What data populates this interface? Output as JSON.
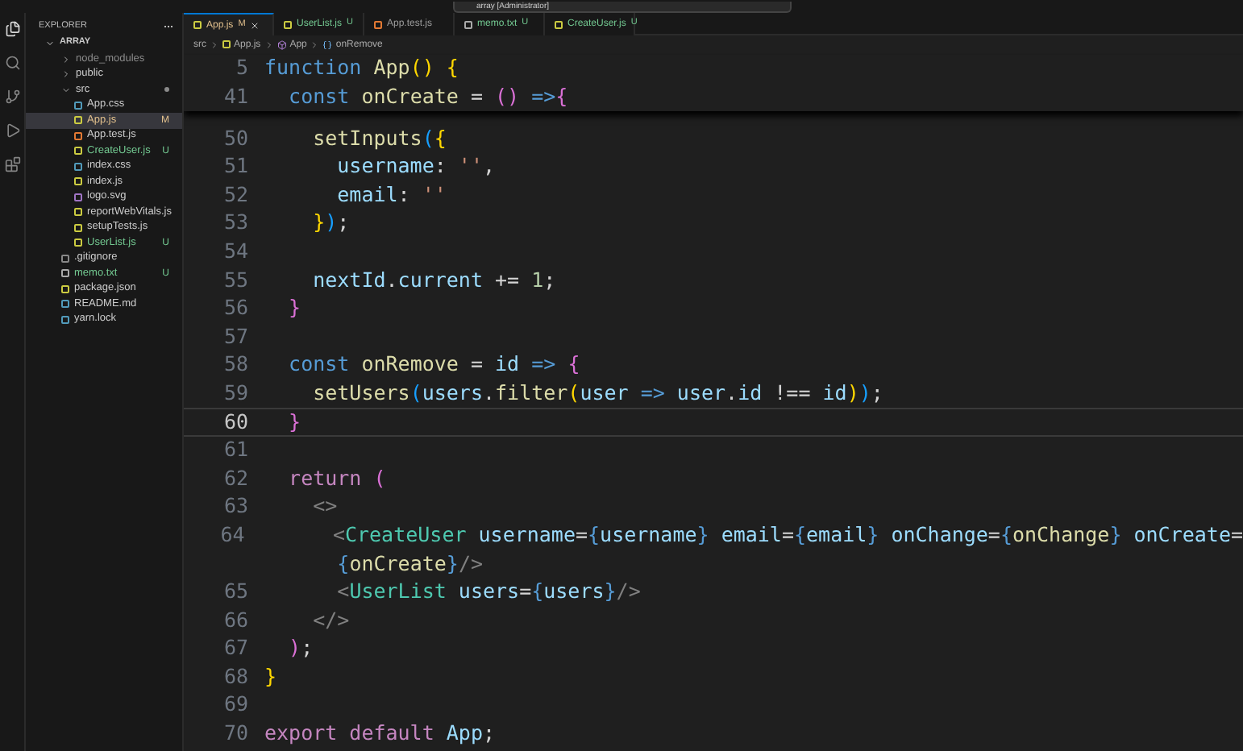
{
  "search_box": {
    "text": "array [Administrator]"
  },
  "explorer": {
    "title": "EXPLORER",
    "root": "ARRAY",
    "tree": [
      {
        "name": "node_modules",
        "kind": "folder",
        "expanded": false,
        "selected": false
      },
      {
        "name": "public",
        "kind": "folder",
        "expanded": false,
        "selected": false
      },
      {
        "name": "src",
        "kind": "folder",
        "expanded": true,
        "has_changes": true,
        "selected": false,
        "children": [
          {
            "name": "App.css",
            "kind": "css",
            "selected": false
          },
          {
            "name": "App.js",
            "kind": "js",
            "status": "M",
            "selected": true
          },
          {
            "name": "App.test.js",
            "kind": "test",
            "selected": false
          },
          {
            "name": "CreateUser.js",
            "kind": "js",
            "status": "U",
            "selected": false
          },
          {
            "name": "index.css",
            "kind": "css",
            "selected": false
          },
          {
            "name": "index.js",
            "kind": "js",
            "selected": false
          },
          {
            "name": "logo.svg",
            "kind": "svg",
            "selected": false
          },
          {
            "name": "reportWebVitals.js",
            "kind": "js",
            "selected": false
          },
          {
            "name": "setupTests.js",
            "kind": "js",
            "selected": false
          },
          {
            "name": "UserList.js",
            "kind": "js",
            "status": "U",
            "selected": false
          }
        ]
      },
      {
        "name": ".gitignore",
        "kind": "git",
        "selected": false
      },
      {
        "name": "memo.txt",
        "kind": "txt",
        "status": "U",
        "selected": false
      },
      {
        "name": "package.json",
        "kind": "json",
        "selected": false
      },
      {
        "name": "README.md",
        "kind": "md",
        "selected": false
      },
      {
        "name": "yarn.lock",
        "kind": "lock",
        "selected": false
      }
    ]
  },
  "tabs": [
    {
      "label": "App.js",
      "kind": "js",
      "status": "M",
      "selected": true
    },
    {
      "label": "UserList.js",
      "kind": "js",
      "status": "U",
      "selected": false
    },
    {
      "label": "App.test.js",
      "kind": "test",
      "selected": false
    },
    {
      "label": "memo.txt",
      "kind": "txt",
      "status": "U",
      "selected": false
    },
    {
      "label": "CreateUser.js",
      "kind": "js",
      "status": "U",
      "selected": false
    }
  ],
  "breadcrumb": [
    {
      "label": "src",
      "kind": "folder"
    },
    {
      "label": "App.js",
      "kind": "js"
    },
    {
      "label": "App",
      "kind": "component"
    },
    {
      "label": "onRemove",
      "kind": "method"
    }
  ],
  "sticky_lines": [
    {
      "number": "5",
      "tokens": [
        {
          "text": "function ",
          "kind": "kw"
        },
        {
          "text": "App",
          "kind": "fn"
        },
        {
          "text": "()",
          "kind": "br1"
        },
        {
          "text": " {",
          "kind": "br1"
        }
      ]
    },
    {
      "number": "41",
      "tokens": [
        {
          "text": "  const ",
          "kind": "kw"
        },
        {
          "text": "onCreate",
          "kind": "fn"
        },
        {
          "text": " = "
        },
        {
          "text": "()",
          "kind": "br2"
        },
        {
          "text": " =>",
          "kind": "kw"
        },
        {
          "text": "{",
          "kind": "br2"
        }
      ]
    }
  ],
  "lines": [
    {
      "number": "50",
      "current": false,
      "tokens": [
        {
          "text": "    setInputs",
          "kind": "fn"
        },
        {
          "text": "(",
          "kind": "br3"
        },
        {
          "text": "{",
          "kind": "br1"
        }
      ]
    },
    {
      "number": "51",
      "current": false,
      "tokens": [
        {
          "text": "      username",
          "kind": "var"
        },
        {
          "text": ": "
        },
        {
          "text": "''",
          "kind": "str"
        },
        {
          "text": ","
        }
      ]
    },
    {
      "number": "52",
      "current": false,
      "tokens": [
        {
          "text": "      email",
          "kind": "var"
        },
        {
          "text": ": "
        },
        {
          "text": "''",
          "kind": "str"
        }
      ]
    },
    {
      "number": "53",
      "current": false,
      "tokens": [
        {
          "text": "    }",
          "kind": "br1"
        },
        {
          "text": ")",
          "kind": "br3"
        },
        {
          "text": ";"
        }
      ]
    },
    {
      "number": "54",
      "current": false
    },
    {
      "number": "55",
      "current": false,
      "tokens": [
        {
          "text": "    nextId",
          "kind": "var"
        },
        {
          "text": "."
        },
        {
          "text": "current",
          "kind": "var"
        },
        {
          "text": " += "
        },
        {
          "text": "1",
          "kind": "num"
        },
        {
          "text": ";"
        }
      ]
    },
    {
      "number": "56",
      "current": false,
      "tokens": [
        {
          "text": "  }",
          "kind": "br2"
        }
      ]
    },
    {
      "number": "57",
      "current": false
    },
    {
      "number": "58",
      "current": false,
      "tokens": [
        {
          "text": "  const ",
          "kind": "kw"
        },
        {
          "text": "onRemove",
          "kind": "fn"
        },
        {
          "text": " = "
        },
        {
          "text": "id",
          "kind": "var"
        },
        {
          "text": " => ",
          "kind": "kw"
        },
        {
          "text": "{",
          "kind": "br2"
        }
      ]
    },
    {
      "number": "59",
      "current": false,
      "tokens": [
        {
          "text": "    setUsers",
          "kind": "fn"
        },
        {
          "text": "(",
          "kind": "br3"
        },
        {
          "text": "users",
          "kind": "var"
        },
        {
          "text": "."
        },
        {
          "text": "filter",
          "kind": "fn"
        },
        {
          "text": "(",
          "kind": "br1"
        },
        {
          "text": "user",
          "kind": "var"
        },
        {
          "text": " => ",
          "kind": "kw"
        },
        {
          "text": "user",
          "kind": "var"
        },
        {
          "text": "."
        },
        {
          "text": "id",
          "kind": "var"
        },
        {
          "text": " !== "
        },
        {
          "text": "id",
          "kind": "var"
        },
        {
          "text": ")",
          "kind": "br1"
        },
        {
          "text": ")",
          "kind": "br3"
        },
        {
          "text": ";"
        }
      ]
    },
    {
      "number": "60",
      "current": true,
      "tokens": [
        {
          "text": "  }",
          "kind": "br2"
        }
      ]
    },
    {
      "number": "61",
      "current": false
    },
    {
      "number": "62",
      "current": false,
      "tokens": [
        {
          "text": "  return ",
          "kind": "ctl"
        },
        {
          "text": "(",
          "kind": "br2"
        }
      ]
    },
    {
      "number": "63",
      "current": false,
      "tokens": [
        {
          "text": "    <>",
          "kind": "punct"
        }
      ]
    },
    {
      "number": "64",
      "current": false,
      "tokens": [
        {
          "text": "      <",
          "kind": "punct"
        },
        {
          "text": "CreateUser",
          "kind": "tag"
        },
        {
          "text": " username",
          "kind": "var"
        },
        {
          "text": "="
        },
        {
          "text": "{",
          "kind": "kw"
        },
        {
          "text": "username",
          "kind": "var"
        },
        {
          "text": "}",
          "kind": "kw"
        },
        {
          "text": " email",
          "kind": "var"
        },
        {
          "text": "="
        },
        {
          "text": "{",
          "kind": "kw"
        },
        {
          "text": "email",
          "kind": "var"
        },
        {
          "text": "}",
          "kind": "kw"
        },
        {
          "text": " onChange",
          "kind": "var"
        },
        {
          "text": "="
        },
        {
          "text": "{",
          "kind": "kw"
        },
        {
          "text": "onChange",
          "kind": "fn"
        },
        {
          "text": "}",
          "kind": "kw"
        },
        {
          "text": " onCreate",
          "kind": "var"
        },
        {
          "text": "="
        }
      ],
      "continuation": [
        {
          "text": "      {",
          "kind": "kw"
        },
        {
          "text": "onCreate",
          "kind": "fn"
        },
        {
          "text": "}",
          "kind": "kw"
        },
        {
          "text": "/>",
          "kind": "punct"
        }
      ]
    },
    {
      "number": "65",
      "current": false,
      "tokens": [
        {
          "text": "      <",
          "kind": "punct"
        },
        {
          "text": "UserList",
          "kind": "tag"
        },
        {
          "text": " users",
          "kind": "var"
        },
        {
          "text": "="
        },
        {
          "text": "{",
          "kind": "kw"
        },
        {
          "text": "users",
          "kind": "var"
        },
        {
          "text": "}",
          "kind": "kw"
        },
        {
          "text": "/>",
          "kind": "punct"
        }
      ]
    },
    {
      "number": "66",
      "current": false,
      "tokens": [
        {
          "text": "    </>",
          "kind": "punct"
        }
      ]
    },
    {
      "number": "67",
      "current": false,
      "tokens": [
        {
          "text": "  )",
          "kind": "br2"
        },
        {
          "text": ";"
        }
      ]
    },
    {
      "number": "68",
      "current": false,
      "tokens": [
        {
          "text": "}",
          "kind": "br1"
        }
      ]
    },
    {
      "number": "69",
      "current": false
    },
    {
      "number": "70",
      "current": false,
      "tokens": [
        {
          "text": "export default ",
          "kind": "ctl"
        },
        {
          "text": "App",
          "kind": "var"
        },
        {
          "text": ";"
        }
      ]
    }
  ]
}
